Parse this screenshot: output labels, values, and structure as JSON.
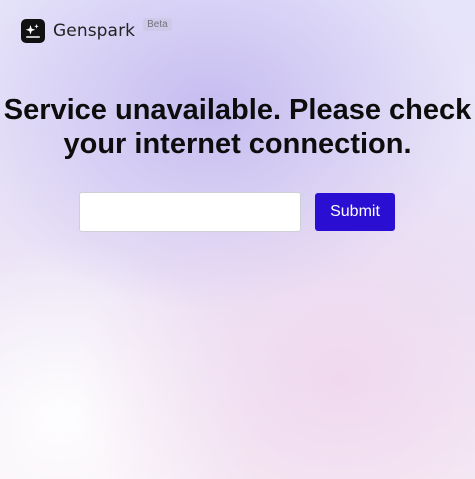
{
  "brand": {
    "name": "Genspark",
    "badge": "Beta",
    "logo_icon": "sparkle-icon"
  },
  "main": {
    "message": "Service unavailable. Please check your internet connection."
  },
  "form": {
    "input_value": "",
    "input_placeholder": "",
    "submit_label": "Submit"
  },
  "colors": {
    "accent": "#2a0ed1",
    "logo_bg": "#111111",
    "text": "#0d0d0d"
  }
}
